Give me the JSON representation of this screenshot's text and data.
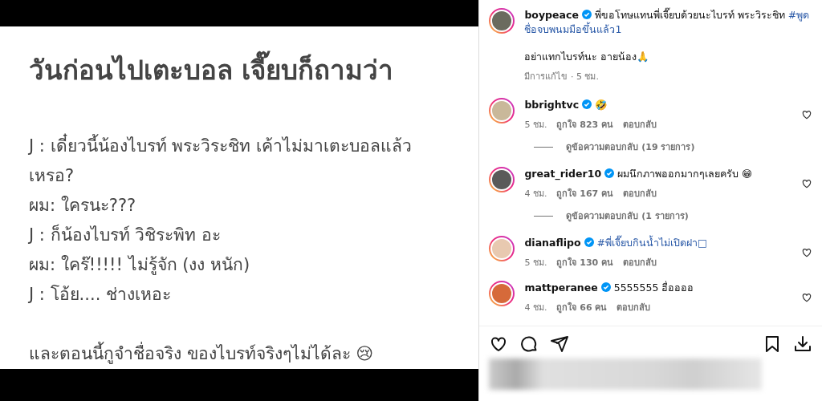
{
  "post_image": {
    "title": "วันก่อนไปเตะบอล เจี๊ยบก็ถามว่า",
    "lines": [
      "J : เดี๋ยวนี้น้องไบรท์ พระวิระชิท เค้าไม่มาเตะบอลแล้ว",
      "เหรอ?",
      "ผม: ใครนะ???",
      "J : ก็น้องไบรท์ วิชิระพิท อะ",
      "ผม: ใคร๊!!!!! ไม่รู้จัก (งง หนัก)",
      "J : โอ้ย.... ช่างเหอะ"
    ],
    "closing_line": "และตอนนี้กูจำชื่อจริง ของไบรท์จริงๆไม่ได้ละ 😢"
  },
  "caption": {
    "username": "boypeace",
    "verified": true,
    "text": "พี่ขอโทษแทนพี่เจี๊ยบด้วยนะไบรท์ พระวิระชิท",
    "hashtag": "#พูดชื่อจบพนมมือขึ้นแล้ว1",
    "second_text": "อย่าแทกไบรท์นะ อายน้อง🙏",
    "meta": "มีการแก้ไข · 5 ชม."
  },
  "comments": [
    {
      "username": "bbrightvc",
      "verified": true,
      "kind": "text",
      "text": "🤣",
      "time": "5 ชม.",
      "likes": "ถูกใจ 823 คน",
      "reply": "ตอบกลับ",
      "view_replies": "ดูข้อความตอบกลับ (19 รายการ)"
    },
    {
      "username": "great_rider10",
      "verified": true,
      "kind": "text",
      "text": "ผมนึกภาพออกมากๆเลยครับ 😁",
      "time": "4 ชม.",
      "likes": "ถูกใจ 167 คน",
      "reply": "ตอบกลับ",
      "view_replies": "ดูข้อความตอบกลับ (1 รายการ)"
    },
    {
      "username": "dianaflipo",
      "verified": true,
      "kind": "hashtag",
      "text": "#พี่เจี๊ยบกินน้ำไม่เปิดฝา□",
      "time": "5 ชม.",
      "likes": "ถูกใจ 130 คน",
      "reply": "ตอบกลับ"
    },
    {
      "username": "mattperanee",
      "verified": true,
      "kind": "text",
      "text": "5555555 ฮื่ออออ",
      "time": "4 ชม.",
      "likes": "ถูกใจ 66 คน",
      "reply": "ตอบกลับ"
    }
  ]
}
